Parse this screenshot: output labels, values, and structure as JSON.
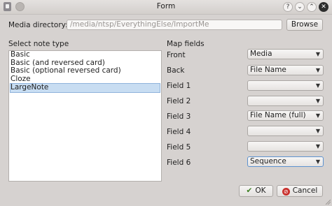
{
  "window": {
    "title": "Form",
    "help_glyph": "?",
    "minimize_glyph": "⌄",
    "maximize_glyph": "⌃",
    "close_glyph": "✕"
  },
  "media": {
    "label": "Media directory:",
    "path": "/media/ntsp/EverythingElse/ImportMe",
    "browse_label": "Browse"
  },
  "note_types": {
    "label": "Select note type",
    "items": [
      "Basic",
      "Basic (and reversed card)",
      "Basic (optional reversed card)",
      "Cloze",
      "LargeNote"
    ],
    "selected_index": 4
  },
  "map_fields": {
    "label": "Map fields",
    "fields": [
      {
        "name": "Front",
        "value": "Media"
      },
      {
        "name": "Back",
        "value": "File Name"
      },
      {
        "name": "Field 1",
        "value": ""
      },
      {
        "name": "Field 2",
        "value": ""
      },
      {
        "name": "Field 3",
        "value": "File Name (full)"
      },
      {
        "name": "Field 4",
        "value": ""
      },
      {
        "name": "Field 5",
        "value": ""
      },
      {
        "name": "Field 6",
        "value": "Sequence"
      }
    ],
    "dropdown_glyph": "▼"
  },
  "buttons": {
    "ok_label": "OK",
    "cancel_label": "Cancel"
  }
}
